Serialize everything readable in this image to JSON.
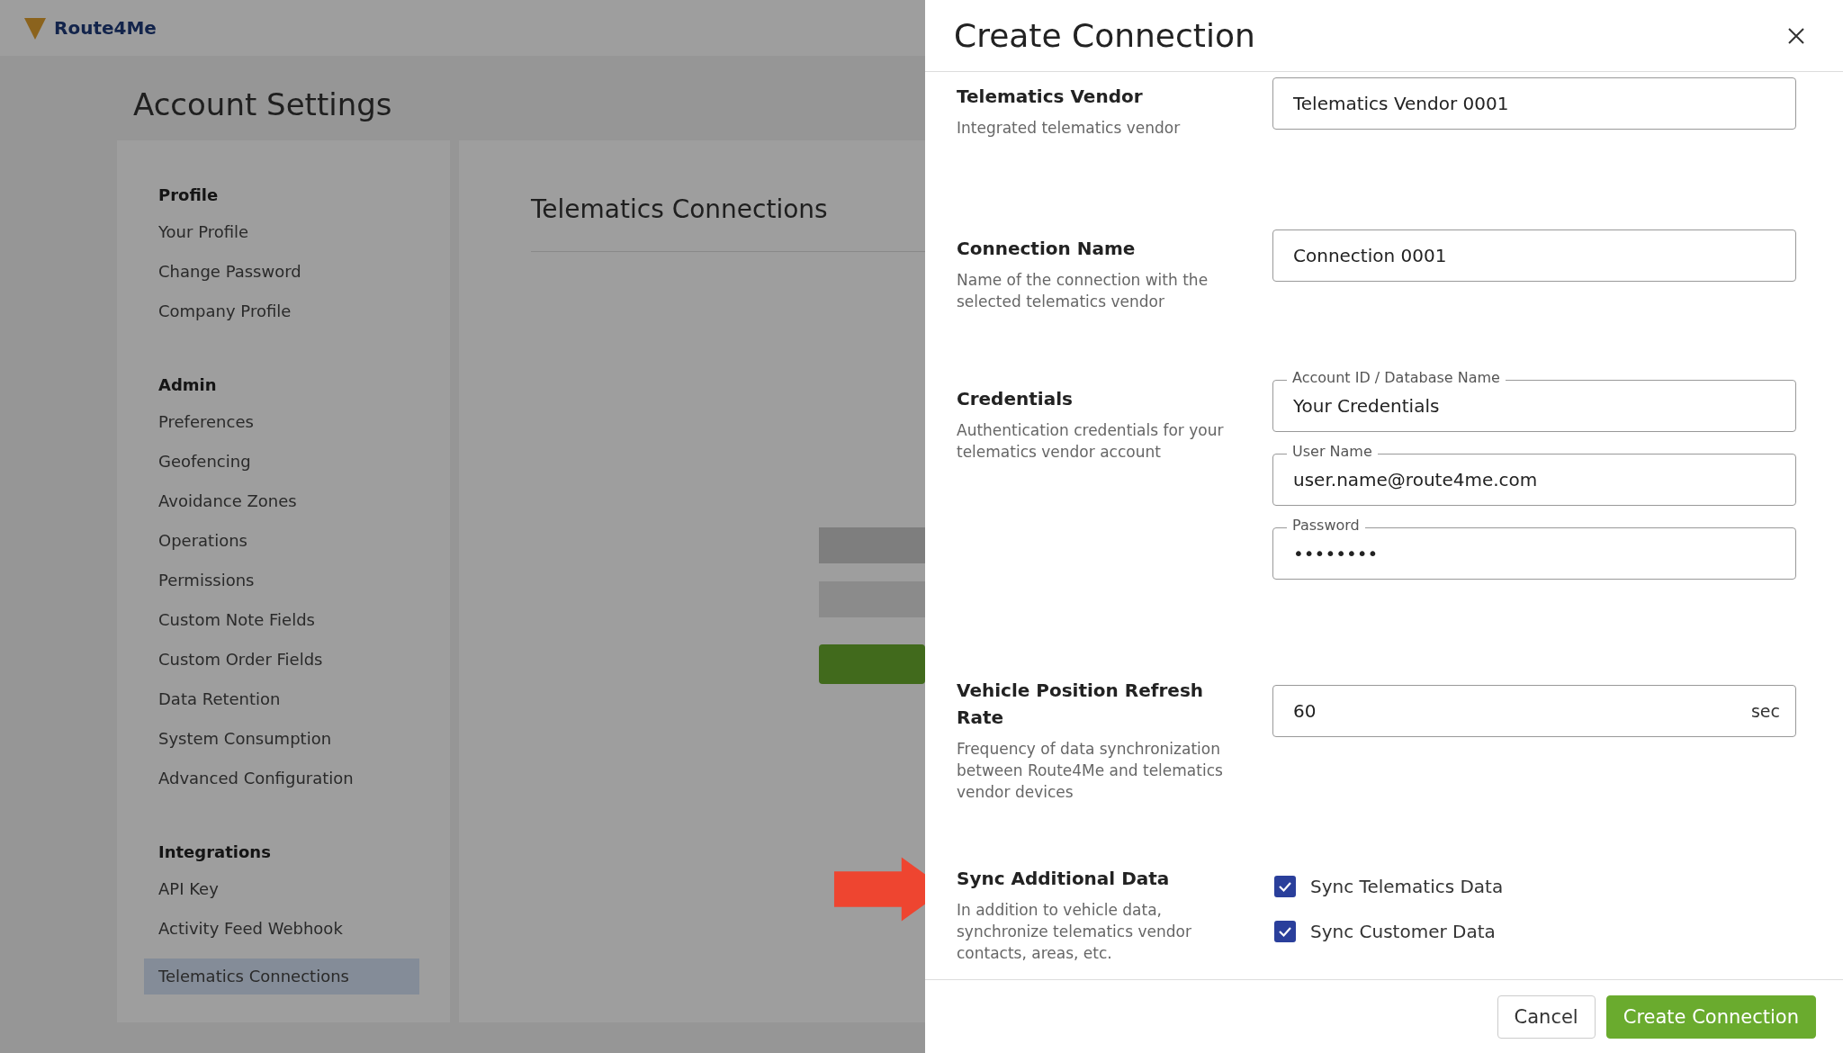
{
  "app": {
    "logo": "Route4Me"
  },
  "page": {
    "title": "Account Settings"
  },
  "sidebar": {
    "groups": [
      {
        "heading": "Profile",
        "items": [
          {
            "label": "Your Profile",
            "selected": false
          },
          {
            "label": "Change Password",
            "selected": false
          },
          {
            "label": "Company Profile",
            "selected": false
          }
        ]
      },
      {
        "heading": "Admin",
        "items": [
          {
            "label": "Preferences",
            "selected": false
          },
          {
            "label": "Geofencing",
            "selected": false
          },
          {
            "label": "Avoidance Zones",
            "selected": false
          },
          {
            "label": "Operations",
            "selected": false
          },
          {
            "label": "Permissions",
            "selected": false
          },
          {
            "label": "Custom Note Fields",
            "selected": false
          },
          {
            "label": "Custom Order Fields",
            "selected": false
          },
          {
            "label": "Data Retention",
            "selected": false
          },
          {
            "label": "System Consumption",
            "selected": false
          },
          {
            "label": "Advanced Configuration",
            "selected": false
          }
        ]
      },
      {
        "heading": "Integrations",
        "items": [
          {
            "label": "API Key",
            "selected": false
          },
          {
            "label": "Activity Feed Webhook",
            "selected": false
          },
          {
            "label": "Telematics Connections",
            "selected": true
          }
        ]
      }
    ]
  },
  "content": {
    "title": "Telematics Connections"
  },
  "dialog": {
    "title": "Create Connection",
    "sections": [
      {
        "kind": "fields",
        "title": "Telematics Vendor",
        "description": "Integrated telematics vendor",
        "fields": [
          {
            "value": "Telematics Vendor 0001"
          }
        ]
      },
      {
        "kind": "fields",
        "title": "Connection Name",
        "description": "Name of the connection with the selected telematics vendor",
        "fields": [
          {
            "value": "Connection 0001"
          }
        ]
      },
      {
        "kind": "fields",
        "title": "Credentials",
        "description": "Authentication credentials for your telematics vendor account",
        "fields": [
          {
            "label": "Account ID / Database Name",
            "value": "Your Credentials"
          },
          {
            "label": "User Name",
            "value": "user.name@route4me.com"
          },
          {
            "label": "Password",
            "value": "••••••••"
          }
        ]
      },
      {
        "kind": "fields",
        "title": "Vehicle Position Refresh Rate",
        "description": "Frequency of data synchronization between Route4Me and telematics vendor devices",
        "fields": [
          {
            "value": "60",
            "suffix": "sec"
          }
        ]
      },
      {
        "kind": "checks",
        "title": "Sync Additional Data",
        "description": "In addition to vehicle data, synchronize telematics vendor contacts, areas, etc.",
        "items": [
          {
            "label": "Sync Telematics Data",
            "checked": true
          },
          {
            "label": "Sync Customer Data",
            "checked": true
          }
        ]
      }
    ],
    "buttons": [
      {
        "label": "Cancel",
        "kind": "secondary"
      },
      {
        "label": "Create Connection",
        "kind": "primary"
      }
    ]
  }
}
